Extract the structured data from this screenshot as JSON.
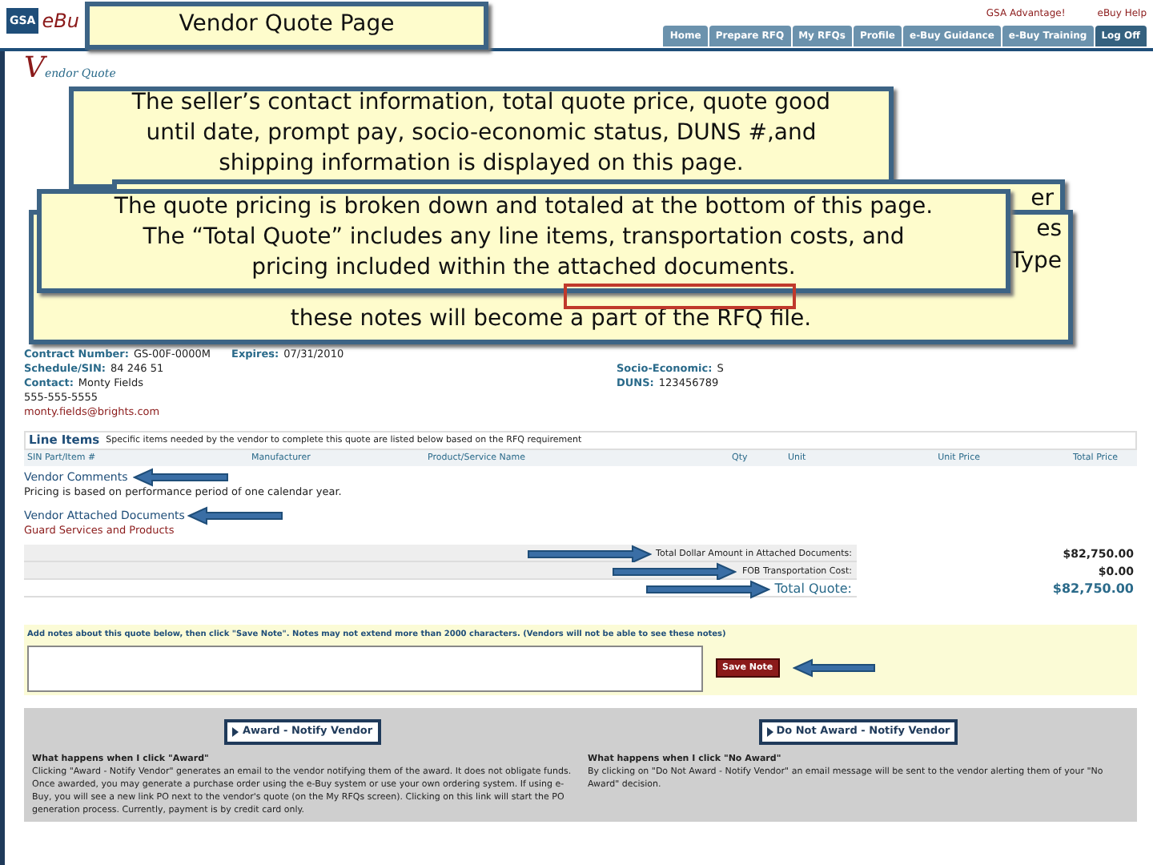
{
  "header": {
    "logo_box": "GSA",
    "logo_text": "eBu",
    "top_links": [
      "GSA Advantage!",
      "eBuy Help"
    ]
  },
  "nav": [
    {
      "label": "Home",
      "kind": "tab"
    },
    {
      "label": "Prepare RFQ",
      "kind": "tab"
    },
    {
      "label": "My RFQs",
      "kind": "tab"
    },
    {
      "label": "Profile",
      "kind": "tab"
    },
    {
      "label": "e-Buy Guidance",
      "kind": "tab"
    },
    {
      "label": "e-Buy Training",
      "kind": "tab"
    },
    {
      "label": "Log Off",
      "kind": "logout"
    }
  ],
  "page_title": {
    "initial": "V",
    "rest": "endor Quote"
  },
  "vendor": {
    "left": [
      {
        "label": "Contract Number:",
        "value": "GS-00F-0000M"
      },
      {
        "label": "Schedule/SIN:",
        "value": "84 246 51"
      },
      {
        "label": "Contact:",
        "value": "Monty Fields"
      },
      {
        "value": "555-555-5555"
      },
      {
        "value": "monty.fields@brights.com",
        "kind": "email"
      }
    ],
    "expires": {
      "label": "Expires:",
      "value": "07/31/2010"
    },
    "right": [
      {
        "label": "Socio-Economic:",
        "value": "S"
      },
      {
        "label": "DUNS:",
        "value": "123456789"
      }
    ]
  },
  "line_items": {
    "title": "Line Items",
    "note": "Specific items needed by the vendor to complete this quote are listed below based on the RFQ requirement",
    "columns": [
      "SIN Part/Item #",
      "Manufacturer",
      "Product/Service Name",
      "Qty",
      "Unit",
      "Unit Price",
      "Total Price"
    ]
  },
  "vendor_comments": {
    "title": "Vendor Comments",
    "text": "Pricing is based on performance period of one calendar year."
  },
  "attached_documents": {
    "title": "Vendor Attached Documents",
    "items": [
      "Guard Services and Products"
    ]
  },
  "totals": [
    {
      "label": "Total Dollar Amount in Attached Documents:",
      "value": "$82,750.00",
      "kind": "plain"
    },
    {
      "label": "FOB Transportation Cost:",
      "value": "$0.00",
      "kind": "plain"
    },
    {
      "label": "Total Quote:",
      "value": "$82,750.00",
      "kind": "total"
    }
  ],
  "notes": {
    "instruction": "Add notes about this quote below, then click \"Save Note\". Notes may not extend more than 2000 characters. (Vendors will not be able to see these notes)",
    "button": "Save Note"
  },
  "award": [
    {
      "button": "Award - Notify Vendor",
      "heading": "What happens when I click \"Award\"",
      "text": "Clicking \"Award - Notify Vendor\" generates an email to the vendor notifying them of the award. It does not obligate funds. Once awarded, you may generate a purchase order using the e-Buy system or use your own ordering system. If using e-Buy, you will see a new link PO next to the vendor's quote (on the My RFQs screen). Clicking on this link will start the PO generation process. Currently, payment is by credit card only."
    },
    {
      "button": "Do Not Award - Notify Vendor",
      "heading": "What happens when I click \"No Award\"",
      "text": "By clicking on \"Do Not Award - Notify Vendor\" an email message will be sent to the vendor alerting them of your \"No Award\" decision."
    }
  ],
  "callouts": [
    {
      "lines": [
        "Vendor Quote Page"
      ]
    },
    {
      "lines": [
        "The seller’s contact information, total quote price, quote good",
        "until date, prompt pay, socio-economic status, DUNS #,and",
        "shipping information is displayed on this page."
      ]
    },
    {
      "fragments": [
        "er"
      ]
    },
    {
      "fragments": [
        "es",
        "Type"
      ],
      "lines": [
        "these notes will become a part of the RFQ file."
      ]
    },
    {
      "lines": [
        "The quote pricing is broken down and totaled at the bottom of this page.",
        "The “Total Quote” includes any line items, transportation costs, and",
        "pricing included within the attached documents."
      ]
    }
  ]
}
